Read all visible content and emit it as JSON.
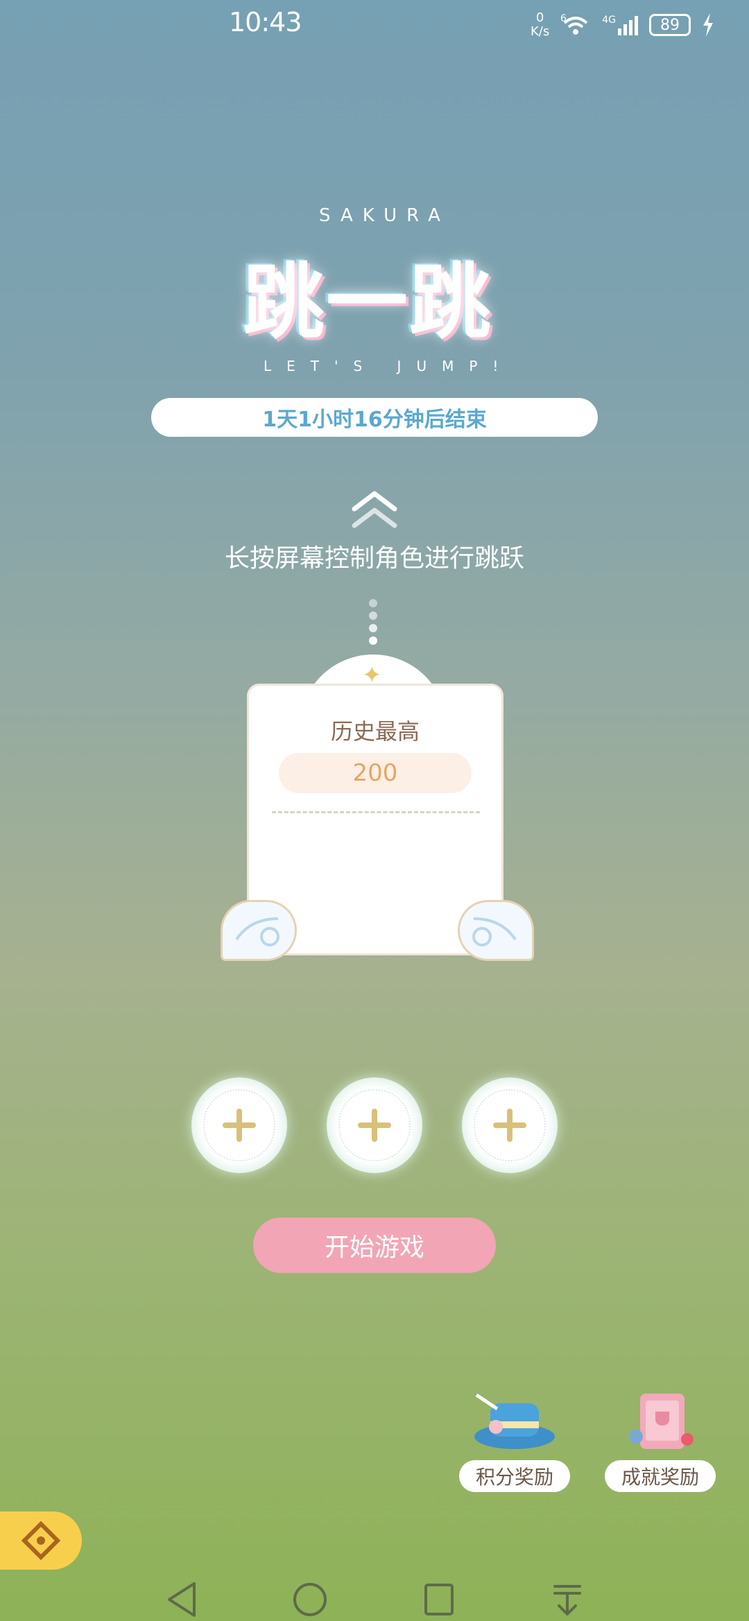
{
  "status_bar": {
    "time": "10:43",
    "net_speed_top": "0",
    "net_speed_bottom": "K/s",
    "sim": "6",
    "network": "4G",
    "battery": "89"
  },
  "logo": {
    "top_text": "SAKURA",
    "title": "跳一跳",
    "subtitle": "LET'S JUMP!"
  },
  "countdown": "1天1小时16分钟后结束",
  "hint": "长按屏幕控制角色进行跳跃",
  "card": {
    "label": "历史最高",
    "value": "200"
  },
  "slots": [
    {
      "icon": "plus-icon"
    },
    {
      "icon": "plus-icon"
    },
    {
      "icon": "plus-icon"
    }
  ],
  "start_button": "开始游戏",
  "rewards": [
    {
      "label": "积分奖励",
      "icon": "hat-icon"
    },
    {
      "label": "成就奖励",
      "icon": "book-icon"
    }
  ],
  "colors": {
    "accent_pink": "#f2a5b5",
    "countdown_blue": "#5aa8cf",
    "plus_gold": "#d9c07a"
  }
}
